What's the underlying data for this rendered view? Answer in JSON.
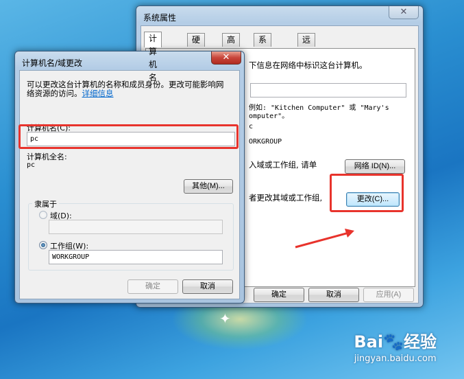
{
  "sys_props": {
    "title": "系统属性",
    "close": "✕",
    "tabs": [
      "计算机名",
      "硬件",
      "高级",
      "系统保护",
      "远程"
    ],
    "desc": "下信息在网络中标识这台计算机。",
    "example_line1": "例如: \"Kitchen Computer\" 或 \"Mary's",
    "example_line2": "omputer\"。",
    "computer_name_partial": "c",
    "workgroup_partial": "ORKGROUP",
    "join_text": "入域或工作组, 请单",
    "network_id_btn": "网络 ID(N)...",
    "change_text": "者更改其域或工作组,",
    "change_btn": "更改(C)...",
    "ok": "确定",
    "cancel": "取消",
    "apply": "应用(A)"
  },
  "name_dialog": {
    "title": "计算机名/域更改",
    "close": "✕",
    "desc_line1": "可以更改这台计算机的名称和成员身份。更改可能影响网",
    "desc_line2": "络资源的访问。",
    "details_link": "详细信息",
    "computer_name_label": "计算机名(C):",
    "computer_name_value": "pc",
    "full_name_label": "计算机全名:",
    "full_name_value": "pc",
    "other_btn": "其他(M)...",
    "member_of": "隶属于",
    "domain_label": "域(D):",
    "domain_value": "",
    "workgroup_label": "工作组(W):",
    "workgroup_value": "WORKGROUP",
    "ok": "确定",
    "cancel": "取消"
  },
  "watermark": {
    "logo": "Bai🐾经验",
    "url": "jingyan.baidu.com"
  },
  "colors": {
    "highlight_red": "#e8332c",
    "link_blue": "#0066cc"
  }
}
